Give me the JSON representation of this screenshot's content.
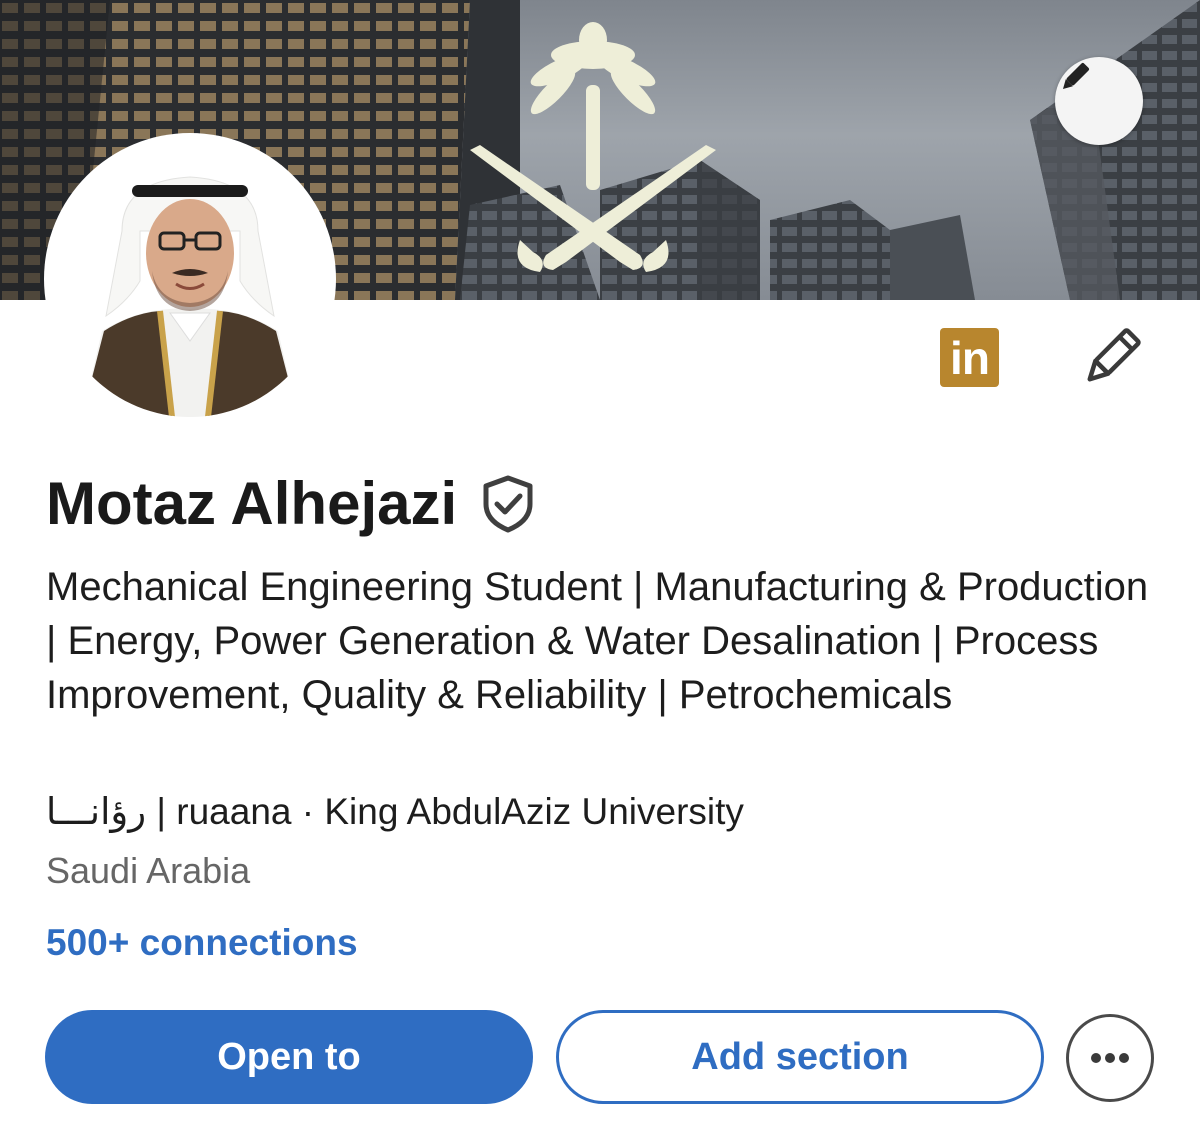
{
  "banner": {
    "image": "saudi-emblem-skyscrapers",
    "edit_icon": "pencil-icon"
  },
  "profile": {
    "avatar": "profile-photo",
    "name": "Motaz Alhejazi",
    "verified_icon": "verified-shield-icon",
    "badge_text": "in",
    "headline": "Mechanical Engineering Student | Manufacturing & Production | Energy, Power Generation & Water Desalination | Process Improvement, Quality & Reliability | Petrochemicals",
    "edu_line": "رؤانـــا | ruaana · King AbdulAziz University",
    "location": "Saudi Arabia",
    "connections": "500+ connections"
  },
  "actions": {
    "open_to": "Open to",
    "add_section": "Add section",
    "more_icon": "more-horizontal-icon"
  },
  "colors": {
    "accent": "#2f6dc2",
    "badge": "#b8862e",
    "text": "#1d1d1d",
    "muted": "#666666"
  }
}
